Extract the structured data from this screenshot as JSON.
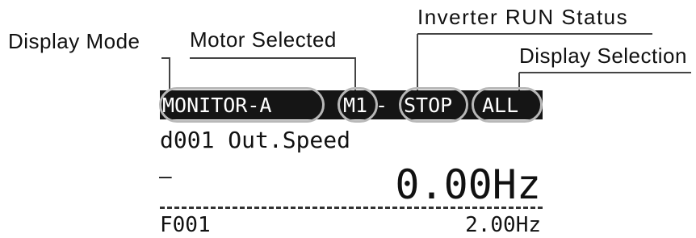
{
  "callouts": {
    "display_mode": "Display Mode",
    "motor_selected": "Motor Selected",
    "inverter_run_status": "Inverter RUN Status",
    "display_selection": "Display Selection"
  },
  "lcd": {
    "status_bar": {
      "mode": "MONITOR-A",
      "motor": "M1",
      "separator": "-",
      "run_status": "STOP",
      "selection": "ALL"
    },
    "parameter_line": "d001 Out.Speed",
    "sign": "–",
    "main_value": "0.00Hz",
    "sub_parameter": "F001",
    "sub_value": "2.00Hz"
  },
  "colors": {
    "status_bar_background": "#151515",
    "status_bar_text": "#ffffff",
    "highlight_ring": "#b8b8b8"
  }
}
